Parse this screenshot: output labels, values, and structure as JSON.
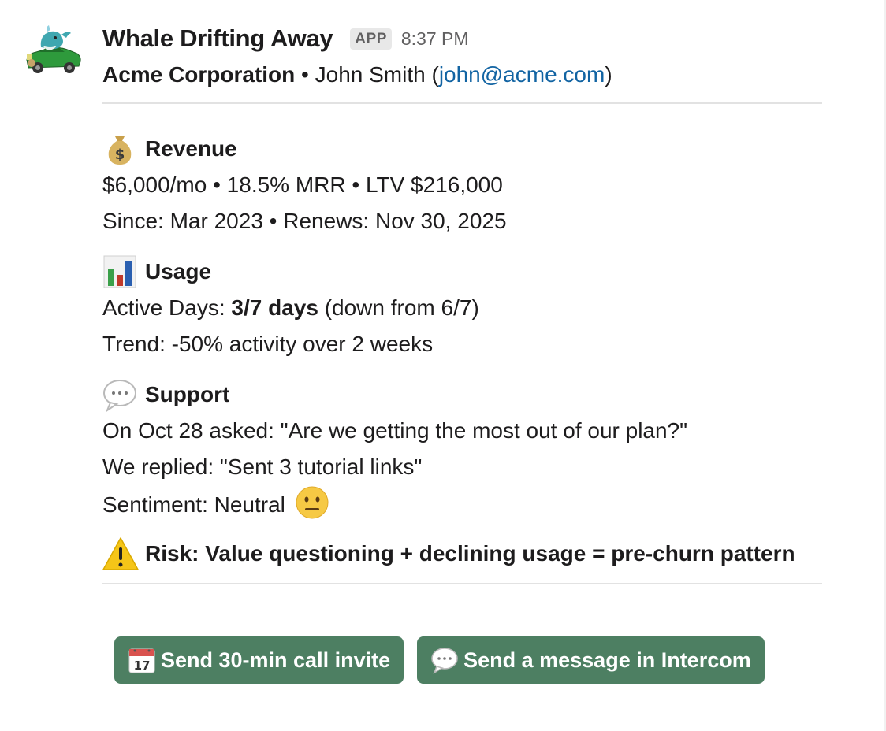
{
  "message": {
    "app_name": "Whale Drifting Away",
    "badge": "APP",
    "time": "8:37 PM",
    "company": "Acme Corporation",
    "separator": " • ",
    "contact_name": "John Smith",
    "email_open": " (",
    "email": "john@acme.com",
    "email_close": ")"
  },
  "revenue": {
    "icon": "money-bag-icon",
    "title": "Revenue",
    "line1": "$6,000/mo • 18.5% MRR • LTV $216,000",
    "line2": "Since: Mar 2023 • Renews: Nov 30, 2025"
  },
  "usage": {
    "icon": "bar-chart-icon",
    "title": "Usage",
    "active_prefix": "Active Days: ",
    "active_value": "3/7 days",
    "active_suffix": " (down from 6/7)",
    "trend": "Trend: -50% activity over 2 weeks"
  },
  "support": {
    "icon": "speech-bubble-icon",
    "title": "Support",
    "asked": "On Oct 28 asked: \"Are we getting the most out of our plan?\"",
    "replied": "We replied: \"Sent 3 tutorial links\"",
    "sentiment": "Sentiment: Neutral",
    "sentiment_icon": "neutral-face-icon"
  },
  "risk": {
    "icon": "warning-icon",
    "text": "Risk: Value questioning + declining usage = pre-churn pattern"
  },
  "actions": {
    "call_button": "Send 30-min call invite",
    "call_icon": "calendar-icon",
    "message_button": "Send a message in Intercom",
    "message_icon": "speech-bubble-icon"
  },
  "colors": {
    "button_bg": "#4d7f62",
    "link": "#1264a3",
    "badge_bg": "#e8e8e8"
  }
}
